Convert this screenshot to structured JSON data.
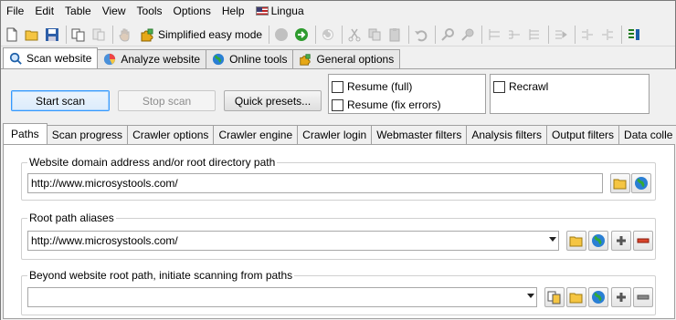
{
  "menu": {
    "file": "File",
    "edit": "Edit",
    "table": "Table",
    "view": "View",
    "tools": "Tools",
    "options": "Options",
    "help": "Help",
    "lingua": "Lingua"
  },
  "toolbar": {
    "easy_mode_label": "Simplified easy mode"
  },
  "main_tabs": [
    {
      "label": "Scan website",
      "icon": "magnifier-icon",
      "active": true
    },
    {
      "label": "Analyze website",
      "icon": "pie-chart-icon",
      "active": false
    },
    {
      "label": "Online tools",
      "icon": "globe-icon",
      "active": false
    },
    {
      "label": "General options",
      "icon": "puzzle-icon",
      "active": false
    }
  ],
  "scan": {
    "start_label": "Start scan",
    "stop_label": "Stop scan",
    "presets_label": "Quick presets...",
    "resume_full": "Resume (full)",
    "resume_fix": "Resume (fix errors)",
    "recrawl": "Recrawl"
  },
  "sub_tabs": [
    {
      "label": "Paths",
      "active": true
    },
    {
      "label": "Scan progress"
    },
    {
      "label": "Crawler options"
    },
    {
      "label": "Crawler engine"
    },
    {
      "label": "Crawler login"
    },
    {
      "label": "Webmaster filters"
    },
    {
      "label": "Analysis filters"
    },
    {
      "label": "Output filters"
    },
    {
      "label": "Data colle"
    }
  ],
  "paths": {
    "domain_title": "Website domain address and/or root directory path",
    "domain_value": "http://www.microsystools.com/",
    "aliases_title": "Root path aliases",
    "aliases_value": "http://www.microsystools.com/",
    "beyond_title": "Beyond website root path, initiate scanning from paths",
    "beyond_value": ""
  },
  "colors": {
    "accent_border": "#3399ff",
    "tab_border": "#a0a0a0",
    "panel_bg": "#f0f0f0"
  }
}
